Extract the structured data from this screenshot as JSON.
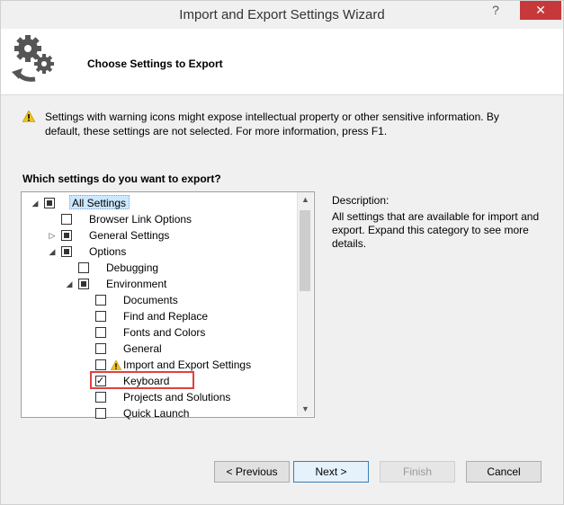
{
  "window": {
    "title": "Import and Export Settings Wizard",
    "help_label": "?",
    "close_label": "✕"
  },
  "header": {
    "title": "Choose Settings to Export"
  },
  "warning": {
    "text": "Settings with warning icons might expose intellectual property or other sensitive information. By default, these settings are not selected. For more information, press F1."
  },
  "question": "Which settings do you want to export?",
  "tree": {
    "items": [
      {
        "label": "All Settings",
        "state": "partial",
        "expander": "collapse"
      },
      {
        "label": "Browser Link Options",
        "state": "unchecked",
        "expander": ""
      },
      {
        "label": "General Settings",
        "state": "partial",
        "expander": "expand"
      },
      {
        "label": "Options",
        "state": "partial",
        "expander": "collapse"
      },
      {
        "label": "Debugging",
        "state": "unchecked",
        "expander": ""
      },
      {
        "label": "Environment",
        "state": "partial",
        "expander": "collapse"
      },
      {
        "label": "Documents",
        "state": "unchecked",
        "expander": ""
      },
      {
        "label": "Find and Replace",
        "state": "unchecked",
        "expander": ""
      },
      {
        "label": "Fonts and Colors",
        "state": "unchecked",
        "expander": ""
      },
      {
        "label": "General",
        "state": "unchecked",
        "expander": ""
      },
      {
        "label": "Import and Export Settings",
        "state": "unchecked",
        "expander": "",
        "warning": true
      },
      {
        "label": "Keyboard",
        "state": "checked",
        "expander": ""
      },
      {
        "label": "Projects and Solutions",
        "state": "unchecked",
        "expander": ""
      },
      {
        "label": "Quick Launch",
        "state": "unchecked",
        "expander": ""
      }
    ]
  },
  "description": {
    "title": "Description:",
    "body": "All settings that are available for import and export. Expand this category to see more details."
  },
  "buttons": {
    "previous": "< Previous",
    "next": "Next >",
    "finish": "Finish",
    "cancel": "Cancel"
  },
  "colors": {
    "close_button": "#c7383a",
    "highlight_box": "#e04040",
    "selection": "#cce8ff"
  }
}
